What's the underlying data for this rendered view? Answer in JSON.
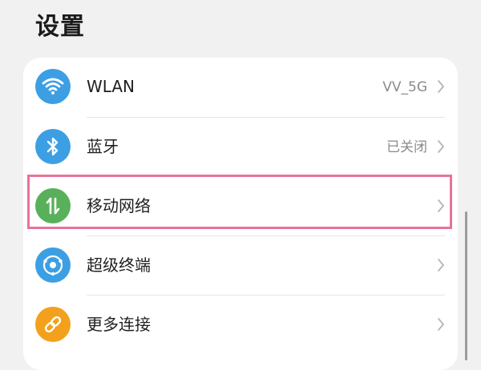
{
  "page": {
    "title": "设置"
  },
  "settings": {
    "items": [
      {
        "label": "WLAN",
        "value": "VV_5G",
        "icon": "wifi-icon",
        "icon_color": "#3d9fe3"
      },
      {
        "label": "蓝牙",
        "value": "已关闭",
        "icon": "bluetooth-icon",
        "icon_color": "#3d9fe3"
      },
      {
        "label": "移动网络",
        "value": "",
        "icon": "mobile-data-icon",
        "icon_color": "#58b15a"
      },
      {
        "label": "超级终端",
        "value": "",
        "icon": "super-device-icon",
        "icon_color": "#3d9fe3"
      },
      {
        "label": "更多连接",
        "value": "",
        "icon": "link-icon",
        "icon_color": "#f3a11c"
      }
    ]
  },
  "highlight": {
    "color": "#e8729a",
    "target": "移动网络"
  }
}
